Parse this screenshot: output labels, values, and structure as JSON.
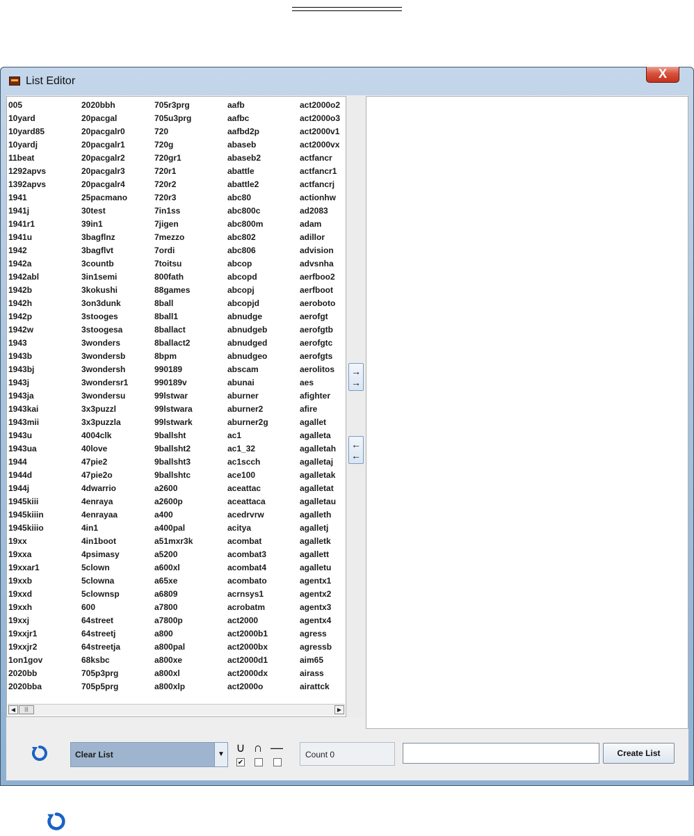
{
  "window": {
    "title": "List Editor",
    "close_label": "X"
  },
  "left_list": {
    "columns": [
      [
        "005",
        "10yard",
        "10yard85",
        "10yardj",
        "11beat",
        "1292apvs",
        "1392apvs",
        "1941",
        "1941j",
        "1941r1",
        "1941u",
        "1942",
        "1942a",
        "1942abl",
        "1942b",
        "1942h",
        "1942p",
        "1942w",
        "1943",
        "1943b",
        "1943bj",
        "1943j",
        "1943ja",
        "1943kai",
        "1943mii",
        "1943u",
        "1943ua",
        "1944",
        "1944d",
        "1944j",
        "1945kiii",
        "1945kiiin",
        "1945kiiio",
        "19xx",
        "19xxa",
        "19xxar1",
        "19xxb",
        "19xxd",
        "19xxh",
        "19xxj",
        "19xxjr1",
        "19xxjr2",
        "1on1gov",
        "2020bb",
        "2020bba"
      ],
      [
        "2020bbh",
        "20pacgal",
        "20pacgalr0",
        "20pacgalr1",
        "20pacgalr2",
        "20pacgalr3",
        "20pacgalr4",
        "25pacmano",
        "30test",
        "39in1",
        "3bagflnz",
        "3bagflvt",
        "3countb",
        "3in1semi",
        "3kokushi",
        "3on3dunk",
        "3stooges",
        "3stoogesa",
        "3wonders",
        "3wondersb",
        "3wondersh",
        "3wondersr1",
        "3wondersu",
        "3x3puzzl",
        "3x3puzzla",
        "4004clk",
        "40love",
        "47pie2",
        "47pie2o",
        "4dwarrio",
        "4enraya",
        "4enrayaa",
        "4in1",
        "4in1boot",
        "4psimasy",
        "5clown",
        "5clowna",
        "5clownsp",
        "600",
        "64street",
        "64streetj",
        "64streetja",
        "68ksbc",
        "705p3prg",
        "705p5prg"
      ],
      [
        "705r3prg",
        "705u3prg",
        "720",
        "720g",
        "720gr1",
        "720r1",
        "720r2",
        "720r3",
        "7in1ss",
        "7jigen",
        "7mezzo",
        "7ordi",
        "7toitsu",
        "800fath",
        "88games",
        "8ball",
        "8ball1",
        "8ballact",
        "8ballact2",
        "8bpm",
        "990189",
        "990189v",
        "99lstwar",
        "99lstwara",
        "99lstwark",
        "9ballsht",
        "9ballsht2",
        "9ballsht3",
        "9ballshtc",
        "a2600",
        "a2600p",
        "a400",
        "a400pal",
        "a51mxr3k",
        "a5200",
        "a600xl",
        "a65xe",
        "a6809",
        "a7800",
        "a7800p",
        "a800",
        "a800pal",
        "a800xe",
        "a800xl",
        "a800xlp"
      ],
      [
        "aafb",
        "aafbc",
        "aafbd2p",
        "abaseb",
        "abaseb2",
        "abattle",
        "abattle2",
        "abc80",
        "abc800c",
        "abc800m",
        "abc802",
        "abc806",
        "abcop",
        "abcopd",
        "abcopj",
        "abcopjd",
        "abnudge",
        "abnudgeb",
        "abnudged",
        "abnudgeo",
        "abscam",
        "abunai",
        "aburner",
        "aburner2",
        "aburner2g",
        "ac1",
        "ac1_32",
        "ac1scch",
        "ace100",
        "aceattac",
        "aceattaca",
        "acedrvrw",
        "acitya",
        "acombat",
        "acombat3",
        "acombat4",
        "acombato",
        "acrnsys1",
        "acrobatm",
        "act2000",
        "act2000b1",
        "act2000bx",
        "act2000d1",
        "act2000dx",
        "act2000o"
      ],
      [
        "act2000o2",
        "act2000o3",
        "act2000v1",
        "act2000vx",
        "actfancr",
        "actfancr1",
        "actfancrj",
        "actionhw",
        "ad2083",
        "adam",
        "adillor",
        "advision",
        "advsnha",
        "aerfboo2",
        "aerfboot",
        "aeroboto",
        "aerofgt",
        "aerofgtb",
        "aerofgtc",
        "aerofgts",
        "aerolitos",
        "aes",
        "afighter",
        "afire",
        "agallet",
        "agalleta",
        "agalletah",
        "agalletaj",
        "agalletak",
        "agalletat",
        "agalletau",
        "agalleth",
        "agalletj",
        "agalletk",
        "agallett",
        "agalletu",
        "agentx1",
        "agentx2",
        "agentx3",
        "agentx4",
        "agress",
        "agressb",
        "aim65",
        "airass",
        "airattck"
      ]
    ]
  },
  "transfer": {
    "add_label": "→\n→",
    "remove_label": "←\n←"
  },
  "bottom": {
    "mode_value": "Clear List",
    "union_symbol": "∪",
    "intersect_symbol": "∩",
    "subtract_symbol": "—",
    "union_checked_mark": "✔",
    "count_label": "Count 0",
    "name_value": "",
    "create_label": "Create List"
  },
  "colors": {
    "refresh_icon": "#1a63c4",
    "select_bg": "#9fb5cf",
    "close_red": "#c1321c"
  }
}
